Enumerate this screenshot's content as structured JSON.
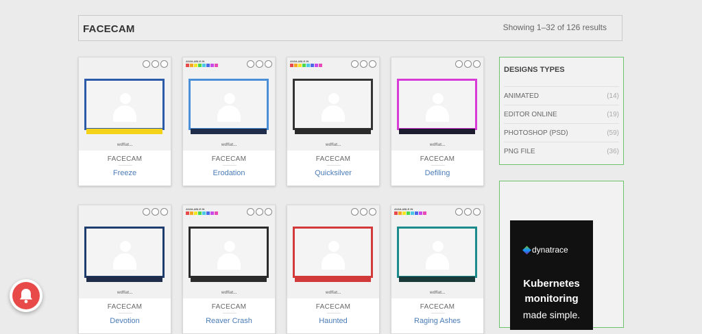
{
  "header": {
    "title": "FACECAM",
    "results": "Showing 1–32 of 126 results"
  },
  "cards": [
    {
      "name": "Freeze",
      "category": "FACECAM",
      "accent": "#2a5aa8",
      "bar": "#f5d21a",
      "available": false,
      "watermark": "wdflat..."
    },
    {
      "name": "Erodation",
      "category": "FACECAM",
      "accent": "#4a8fd8",
      "bar": "#1f2d4a",
      "available": true,
      "watermark": "wdflat..."
    },
    {
      "name": "Quicksilver",
      "category": "FACECAM",
      "accent": "#333333",
      "bar": "#2a2a2a",
      "available": true,
      "watermark": "wdflat..."
    },
    {
      "name": "Defiling",
      "category": "FACECAM",
      "accent": "#d83ad8",
      "bar": "#1c1c2e",
      "available": false,
      "watermark": "wdflat..."
    },
    {
      "name": "Devotion",
      "category": "FACECAM",
      "accent": "#1f3c6e",
      "bar": "#1f2d4a",
      "available": false,
      "watermark": "wdflat..."
    },
    {
      "name": "Reaver Crash",
      "category": "FACECAM",
      "accent": "#2b2b2b",
      "bar": "#2b2b2b",
      "available": true,
      "watermark": "wdflat..."
    },
    {
      "name": "Haunted",
      "category": "FACECAM",
      "accent": "#d23a3a",
      "bar": "#d23a3a",
      "available": false,
      "watermark": "wdflat..."
    },
    {
      "name": "Raging Ashes",
      "category": "FACECAM",
      "accent": "#1a8a8a",
      "bar": "#1a3a3a",
      "available": true,
      "watermark": "wdflat..."
    }
  ],
  "available_label": "AVAILABLE IN",
  "swatch_colors": [
    "#e84a4a",
    "#f5a623",
    "#f5e623",
    "#4ad84a",
    "#4ac8e8",
    "#4a6ae8",
    "#c84ae8",
    "#e84ab8"
  ],
  "sidebar": {
    "title": "DESIGNS TYPES",
    "types": [
      {
        "label": "ANIMATED",
        "count": "(14)"
      },
      {
        "label": "EDITOR ONLINE",
        "count": "(19)"
      },
      {
        "label": "PHOTOSHOP (PSD)",
        "count": "(59)"
      },
      {
        "label": "PNG FILE",
        "count": "(36)"
      }
    ]
  },
  "ad": {
    "brand": "dynatrace",
    "line1": "Kubernetes",
    "line2": "monitoring",
    "line3": "made simple."
  }
}
